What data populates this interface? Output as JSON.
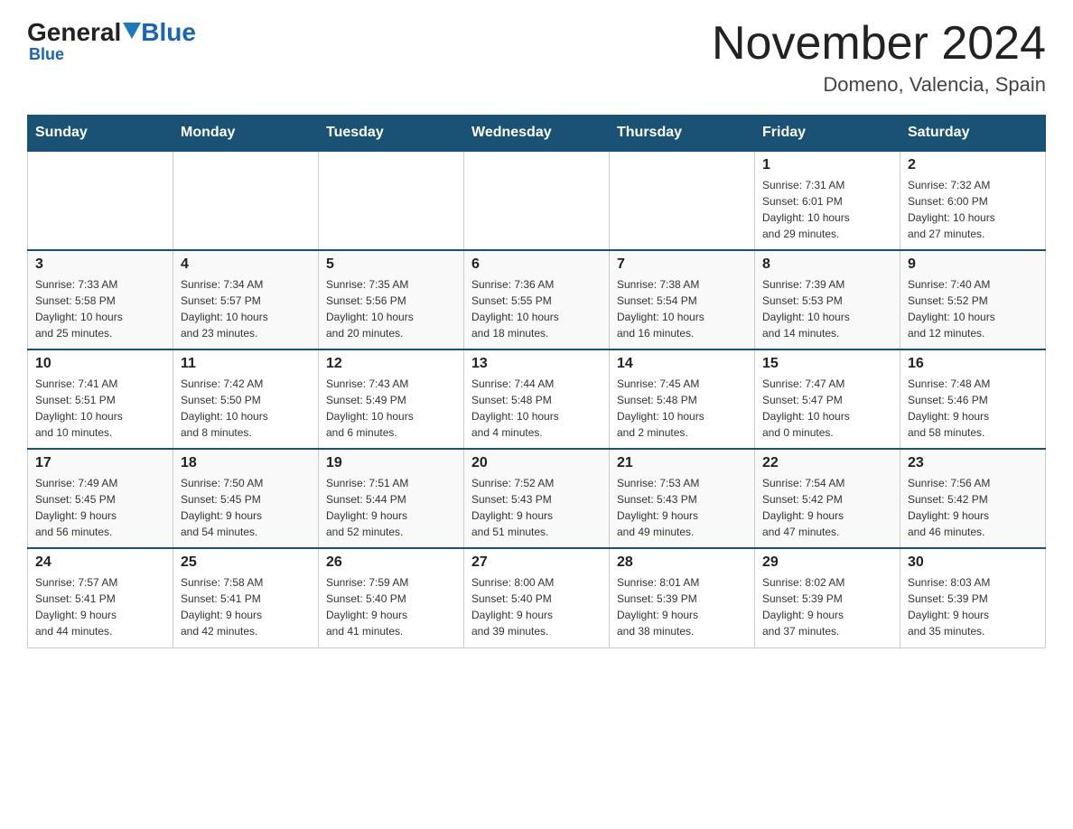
{
  "header": {
    "logo_general": "General",
    "logo_blue": "Blue",
    "main_title": "November 2024",
    "subtitle": "Domeno, Valencia, Spain"
  },
  "days_of_week": [
    "Sunday",
    "Monday",
    "Tuesday",
    "Wednesday",
    "Thursday",
    "Friday",
    "Saturday"
  ],
  "weeks": [
    {
      "days": [
        {
          "date": "",
          "info": ""
        },
        {
          "date": "",
          "info": ""
        },
        {
          "date": "",
          "info": ""
        },
        {
          "date": "",
          "info": ""
        },
        {
          "date": "",
          "info": ""
        },
        {
          "date": "1",
          "info": "Sunrise: 7:31 AM\nSunset: 6:01 PM\nDaylight: 10 hours\nand 29 minutes."
        },
        {
          "date": "2",
          "info": "Sunrise: 7:32 AM\nSunset: 6:00 PM\nDaylight: 10 hours\nand 27 minutes."
        }
      ]
    },
    {
      "days": [
        {
          "date": "3",
          "info": "Sunrise: 7:33 AM\nSunset: 5:58 PM\nDaylight: 10 hours\nand 25 minutes."
        },
        {
          "date": "4",
          "info": "Sunrise: 7:34 AM\nSunset: 5:57 PM\nDaylight: 10 hours\nand 23 minutes."
        },
        {
          "date": "5",
          "info": "Sunrise: 7:35 AM\nSunset: 5:56 PM\nDaylight: 10 hours\nand 20 minutes."
        },
        {
          "date": "6",
          "info": "Sunrise: 7:36 AM\nSunset: 5:55 PM\nDaylight: 10 hours\nand 18 minutes."
        },
        {
          "date": "7",
          "info": "Sunrise: 7:38 AM\nSunset: 5:54 PM\nDaylight: 10 hours\nand 16 minutes."
        },
        {
          "date": "8",
          "info": "Sunrise: 7:39 AM\nSunset: 5:53 PM\nDaylight: 10 hours\nand 14 minutes."
        },
        {
          "date": "9",
          "info": "Sunrise: 7:40 AM\nSunset: 5:52 PM\nDaylight: 10 hours\nand 12 minutes."
        }
      ]
    },
    {
      "days": [
        {
          "date": "10",
          "info": "Sunrise: 7:41 AM\nSunset: 5:51 PM\nDaylight: 10 hours\nand 10 minutes."
        },
        {
          "date": "11",
          "info": "Sunrise: 7:42 AM\nSunset: 5:50 PM\nDaylight: 10 hours\nand 8 minutes."
        },
        {
          "date": "12",
          "info": "Sunrise: 7:43 AM\nSunset: 5:49 PM\nDaylight: 10 hours\nand 6 minutes."
        },
        {
          "date": "13",
          "info": "Sunrise: 7:44 AM\nSunset: 5:48 PM\nDaylight: 10 hours\nand 4 minutes."
        },
        {
          "date": "14",
          "info": "Sunrise: 7:45 AM\nSunset: 5:48 PM\nDaylight: 10 hours\nand 2 minutes."
        },
        {
          "date": "15",
          "info": "Sunrise: 7:47 AM\nSunset: 5:47 PM\nDaylight: 10 hours\nand 0 minutes."
        },
        {
          "date": "16",
          "info": "Sunrise: 7:48 AM\nSunset: 5:46 PM\nDaylight: 9 hours\nand 58 minutes."
        }
      ]
    },
    {
      "days": [
        {
          "date": "17",
          "info": "Sunrise: 7:49 AM\nSunset: 5:45 PM\nDaylight: 9 hours\nand 56 minutes."
        },
        {
          "date": "18",
          "info": "Sunrise: 7:50 AM\nSunset: 5:45 PM\nDaylight: 9 hours\nand 54 minutes."
        },
        {
          "date": "19",
          "info": "Sunrise: 7:51 AM\nSunset: 5:44 PM\nDaylight: 9 hours\nand 52 minutes."
        },
        {
          "date": "20",
          "info": "Sunrise: 7:52 AM\nSunset: 5:43 PM\nDaylight: 9 hours\nand 51 minutes."
        },
        {
          "date": "21",
          "info": "Sunrise: 7:53 AM\nSunset: 5:43 PM\nDaylight: 9 hours\nand 49 minutes."
        },
        {
          "date": "22",
          "info": "Sunrise: 7:54 AM\nSunset: 5:42 PM\nDaylight: 9 hours\nand 47 minutes."
        },
        {
          "date": "23",
          "info": "Sunrise: 7:56 AM\nSunset: 5:42 PM\nDaylight: 9 hours\nand 46 minutes."
        }
      ]
    },
    {
      "days": [
        {
          "date": "24",
          "info": "Sunrise: 7:57 AM\nSunset: 5:41 PM\nDaylight: 9 hours\nand 44 minutes."
        },
        {
          "date": "25",
          "info": "Sunrise: 7:58 AM\nSunset: 5:41 PM\nDaylight: 9 hours\nand 42 minutes."
        },
        {
          "date": "26",
          "info": "Sunrise: 7:59 AM\nSunset: 5:40 PM\nDaylight: 9 hours\nand 41 minutes."
        },
        {
          "date": "27",
          "info": "Sunrise: 8:00 AM\nSunset: 5:40 PM\nDaylight: 9 hours\nand 39 minutes."
        },
        {
          "date": "28",
          "info": "Sunrise: 8:01 AM\nSunset: 5:39 PM\nDaylight: 9 hours\nand 38 minutes."
        },
        {
          "date": "29",
          "info": "Sunrise: 8:02 AM\nSunset: 5:39 PM\nDaylight: 9 hours\nand 37 minutes."
        },
        {
          "date": "30",
          "info": "Sunrise: 8:03 AM\nSunset: 5:39 PM\nDaylight: 9 hours\nand 35 minutes."
        }
      ]
    }
  ]
}
